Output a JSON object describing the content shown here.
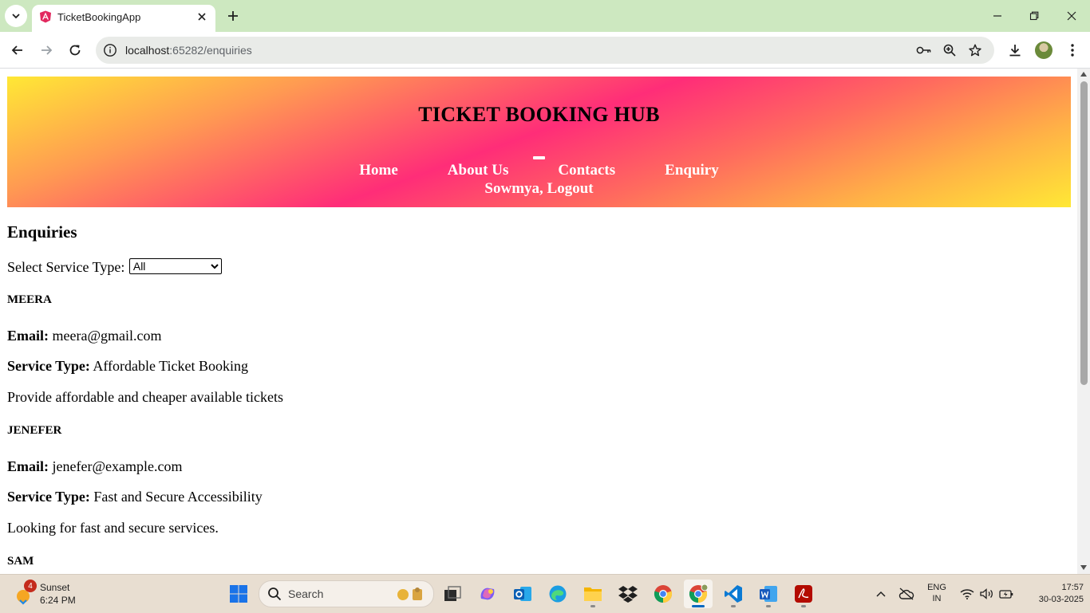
{
  "browser": {
    "tab_title": "TicketBookingApp",
    "url_host": "localhost",
    "url_path": ":65282/enquiries"
  },
  "page": {
    "site_title": "TICKET BOOKING HUB",
    "nav": [
      "Home",
      "About Us",
      "Contacts",
      "Enquiry"
    ],
    "user_logout": "Sowmya, Logout",
    "heading": "Enquiries",
    "filter_label": "Select Service Type:",
    "filter_value": "All",
    "email_label": "Email:",
    "service_label": "Service Type:",
    "enquiries": [
      {
        "name": "MEERA",
        "email": "meera@gmail.com",
        "service_type": "Affordable Ticket Booking",
        "message": "Provide affordable and cheaper available tickets"
      },
      {
        "name": "JENEFER",
        "email": "jenefer@example.com",
        "service_type": "Fast and Secure Accessibility",
        "message": "Looking for fast and secure services."
      },
      {
        "name": "SAM"
      }
    ]
  },
  "taskbar": {
    "weather_badge": "4",
    "weather_name": "Sunset",
    "weather_time": "6:24 PM",
    "search_label": "Search",
    "lang_top": "ENG",
    "lang_bottom": "IN",
    "clock_time": "17:57",
    "clock_date": "30-03-2025"
  },
  "colors": {
    "tabstrip": "#cde8c0",
    "hero_yellow": "#ffe835",
    "hero_pink": "#ff2d78",
    "hero_orange": "#ff9a52",
    "taskbar": "#e8ded1"
  }
}
